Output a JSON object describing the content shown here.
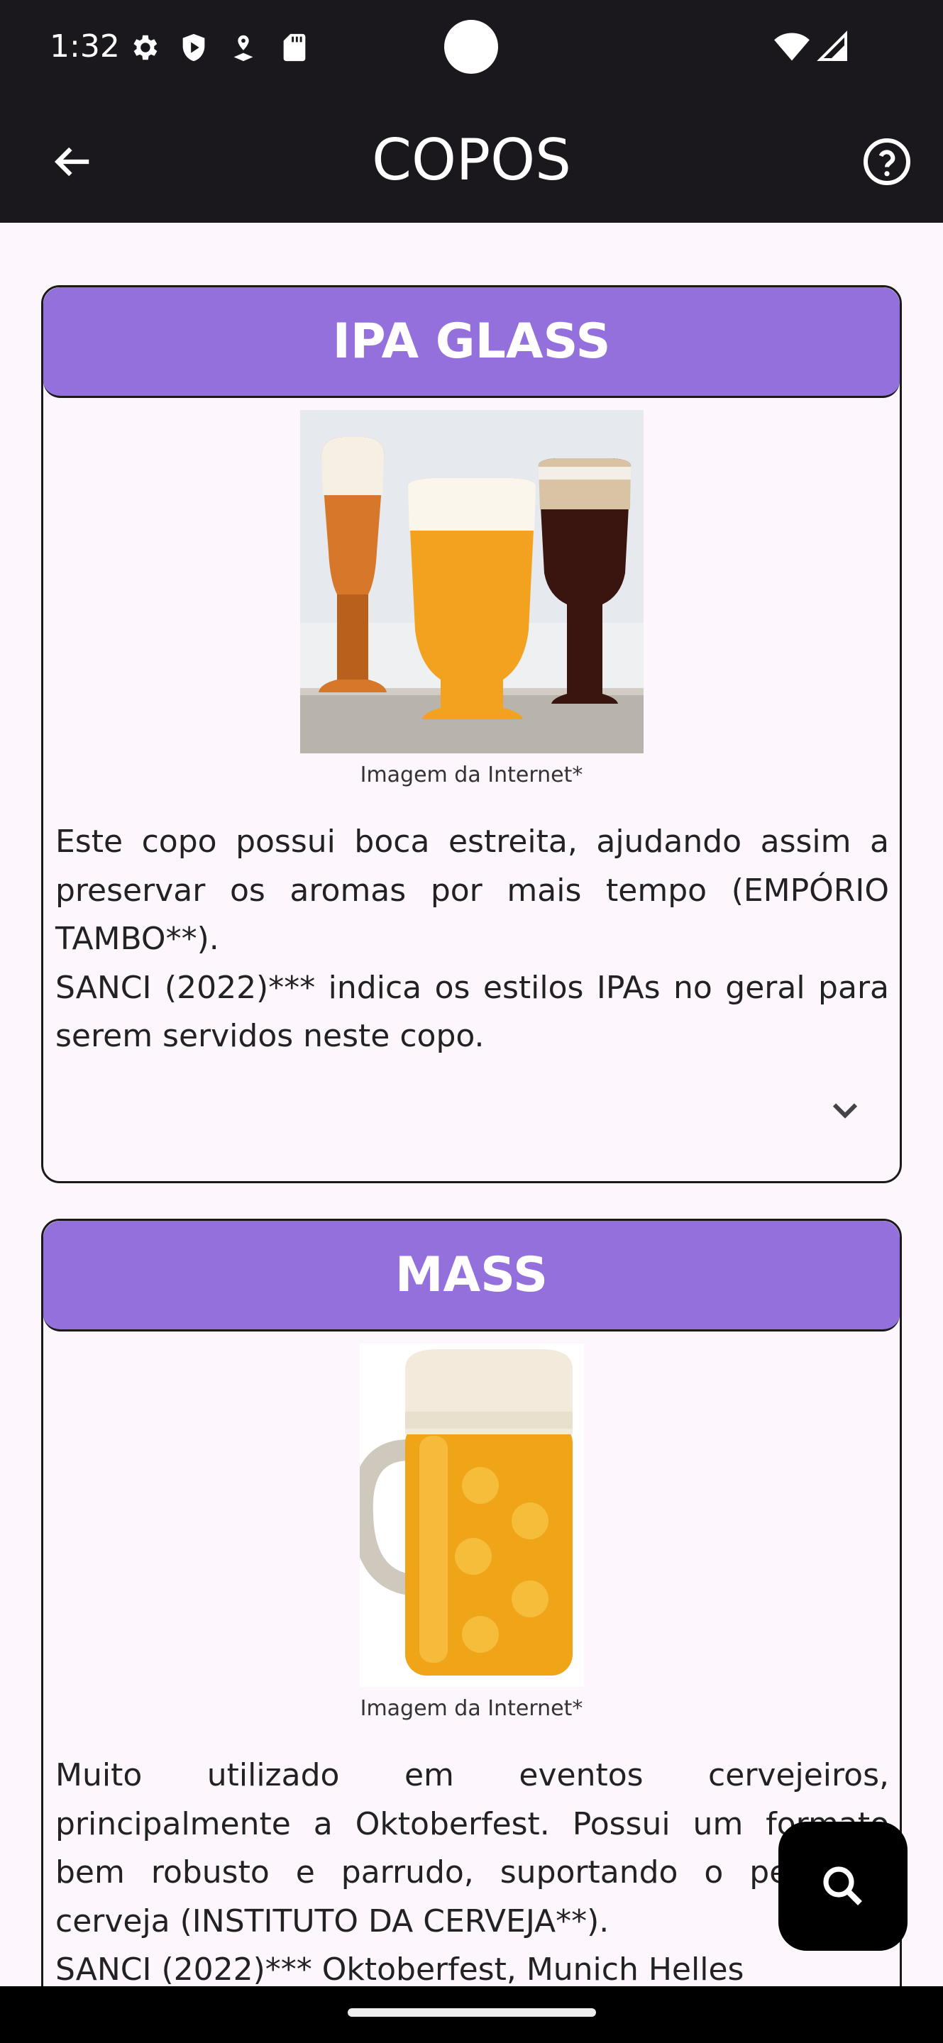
{
  "status_bar": {
    "time": "1:32",
    "icons": [
      "gear-icon",
      "shield-play-icon",
      "location-pin-icon",
      "sd-card-icon",
      "wifi-icon",
      "signal-icon"
    ]
  },
  "app_bar": {
    "title": "COPOS",
    "back_icon": "arrow-left-icon",
    "help_icon": "help-circle-icon"
  },
  "cards": [
    {
      "title": "IPA GLASS",
      "image": "ipa-glasses-photo",
      "caption": "Imagem da Internet*",
      "description": "Este copo possui boca estreita, ajudando assim a preservar os aromas por mais tempo (EMPÓRIO TAMBO**).\nSANCI (2022)*** indica os estilos IPAs no geral para serem servidos neste copo.",
      "expand_icon": "chevron-down-icon"
    },
    {
      "title": "MASS",
      "image": "mass-beer-mug-photo",
      "caption": "Imagem da Internet*",
      "description": "Muito utilizado em eventos cervejeiros, principalmente a Oktoberfest. Possui um formato bem robusto e parrudo, suportando o peso da cerveja (INSTITUTO DA CERVEJA**).\nSANCI (2022)*** Oktoberfest, Munich Helles"
    }
  ],
  "fab": {
    "icon": "search-icon"
  },
  "colors": {
    "header_bg": "#9370db",
    "app_bar_bg": "#1b181d",
    "content_bg": "#fdf6fd"
  }
}
